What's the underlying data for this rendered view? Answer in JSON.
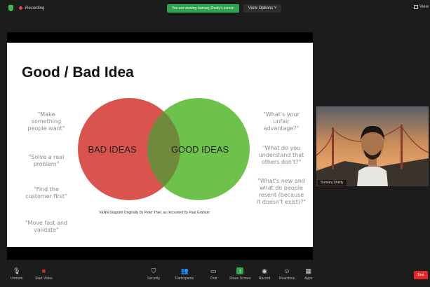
{
  "top_bar": {
    "recording_label": "Recording",
    "banner_text": "You are viewing Sumanj Shetty's screen",
    "view_options_label": "View Options",
    "view_label": "View"
  },
  "slide": {
    "title": "Good / Bad Idea",
    "left_quotes": [
      "\"Make something people want\"",
      "\"Solve a real problem\"",
      "\"Find the customer first\"",
      "\"Move fast and validate\""
    ],
    "right_quotes": [
      "\"What's your unfair advantage?\"",
      "\"What do you understand that others don't?\"",
      "\"What's new and what do people resent (because it doesn't exist)?\""
    ],
    "venn_left_label": "BAD IDEAS",
    "venn_right_label": "GOOD IDEAS",
    "caption": "VENN Diagram Originally by Peter Thiel, as recounted by Paul Graham",
    "colors": {
      "left_circle": "#d9534f",
      "right_circle": "#6cc24a",
      "overlap": "#6f8a3a"
    }
  },
  "participant": {
    "name": "Sumanj Shetty"
  },
  "toolbar": {
    "items": [
      {
        "label": "Unmute",
        "icon": "microphone-icon"
      },
      {
        "label": "Start Video",
        "icon": "video-camera-icon"
      },
      {
        "label": "Security",
        "icon": "shield-icon"
      },
      {
        "label": "Participants",
        "icon": "people-icon"
      },
      {
        "label": "Chat",
        "icon": "chat-icon"
      },
      {
        "label": "Share Screen",
        "icon": "share-screen-icon"
      },
      {
        "label": "Record",
        "icon": "record-icon"
      },
      {
        "label": "Reactions",
        "icon": "reactions-icon"
      },
      {
        "label": "Apps",
        "icon": "apps-icon"
      }
    ],
    "end_label": "End",
    "accent": "#2da44e"
  }
}
